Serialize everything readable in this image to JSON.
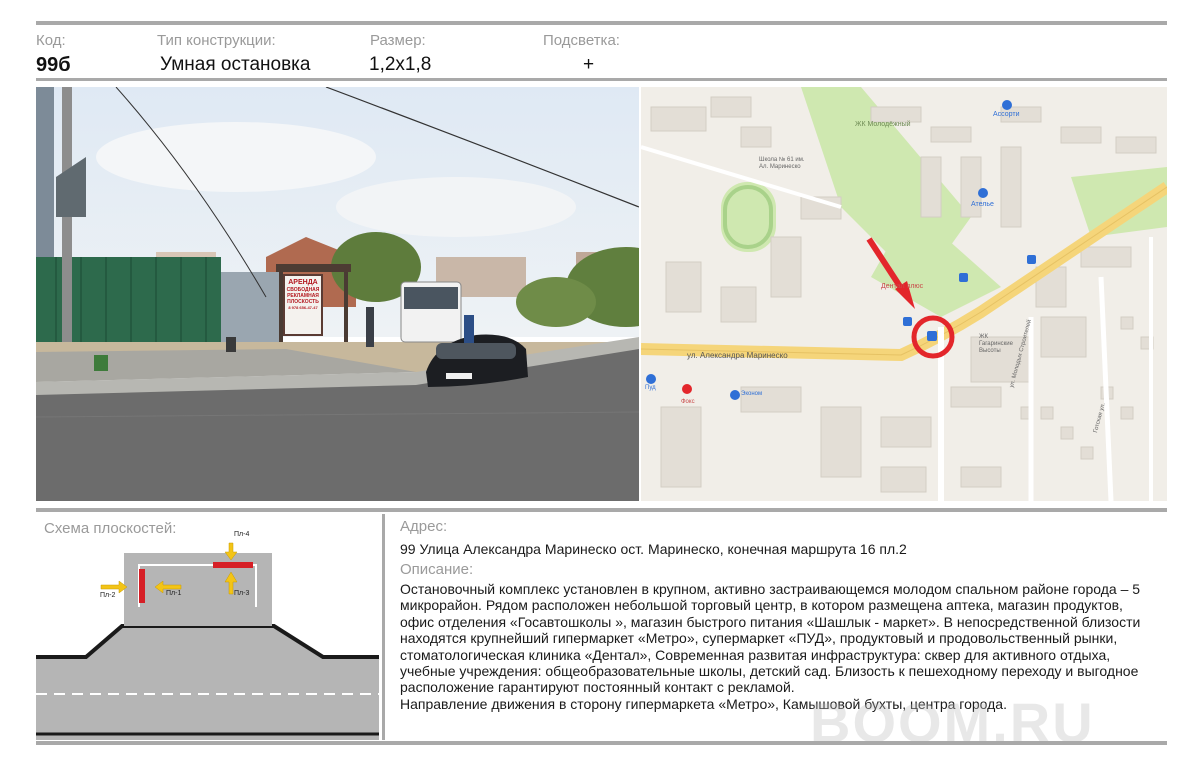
{
  "header": {
    "code_label": "Код:",
    "code_value": "99б",
    "type_label": "Тип конструкции:",
    "type_value": "Умная остановка",
    "size_label": "Размер:",
    "size_value": "1,2x1,8",
    "light_label": "Подсветка:",
    "light_value": "+"
  },
  "photo": {
    "billboard_line1": "АРЕНДА",
    "billboard_line2": "СВОБОДНАЯ",
    "billboard_line3": "РЕКЛАМНАЯ",
    "billboard_line4": "ПЛОСКОСТЬ",
    "billboard_phone": "8 978 656-47-47"
  },
  "map": {
    "label_residential_molodezhny": "ЖК Молодёжный",
    "label_school_line1": "Школа № 61 им.",
    "label_school_line2": "Ал. Маринеско",
    "label_assorti": "Ассорти",
    "label_atelie": "Ателье",
    "label_dental": "Дентал плюс",
    "label_street_marinesko": "ул. Александра Маринеско",
    "label_gagarinskie_line1": "ЖК",
    "label_gagarinskie_line2": "Гагаринские",
    "label_gagarinskie_line3": "Высоты",
    "label_street_sokolova": "ул. Молодых Строителей",
    "label_goticheskaya": "Готская ул.",
    "label_pud": "Пуд",
    "label_ekonom": "Эконом",
    "label_fox": "Фокс",
    "brand_colors": {
      "marker_red": "#e3262b",
      "park_green": "#cfe8b0",
      "road_yellow": "#f5d57a",
      "bus_stop_blue": "#2f6fd6"
    }
  },
  "scheme": {
    "title": "Схема плоскостей:",
    "pl1": "Пл-1",
    "pl2": "Пл-2",
    "pl3": "Пл-3",
    "pl4": "Пл-4"
  },
  "info": {
    "address_label": "Адрес:",
    "address_text": "99  Улица Александра Маринеско ост. Маринеско,  конечная маршрута 16 пл.2",
    "description_label": "Описание:",
    "description_text": "Остановочный комплекс установлен  в крупном, активно застраивающемся  молодом спальном районе города – 5 микрорайон. Рядом расположен небольшой торговый центр, в котором размещена аптека, магазин продуктов, офис   отделения «Госавтошколы »,    магазин быстрого питания «Шашлык - маркет». В непосредственной близости находятся крупнейший  гипермаркет «Метро», супермаркет «ПУД», продуктовый и продовольственный рынки, стоматологическая клиника «Дентал», Современная развитая инфраструктура: сквер для активного отдыха,  учебные учреждения:  общеобразовательные  школы, детский сад.  Близость к пешеходному переходу  и выгодное расположение гарантируют постоянный контакт с рекламой.\nНаправление движения  в сторону гипермаркета «Метро»,  Камышовой бухты, центра города."
  },
  "watermark": "BOOM.RU"
}
